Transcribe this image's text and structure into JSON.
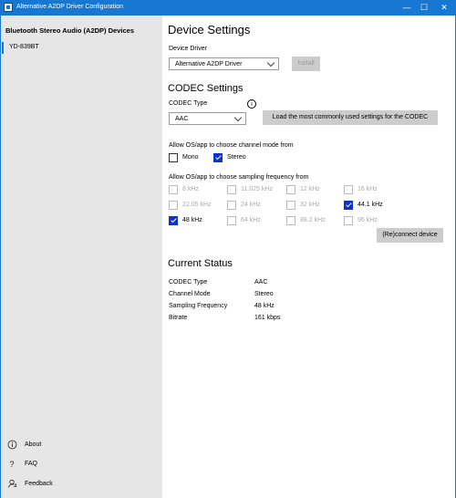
{
  "window": {
    "title": "Alternative A2DP Driver Configuration",
    "minimize": "—",
    "maximize": "☐",
    "close": "✕"
  },
  "sidebar": {
    "header": "Bluetooth Stereo Audio (A2DP) Devices",
    "devices": [
      {
        "label": "YD-839BT",
        "selected": true
      }
    ],
    "footer": [
      {
        "label": "About",
        "icon": "info-icon"
      },
      {
        "label": "FAQ",
        "icon": "question-icon"
      },
      {
        "label": "Feedback",
        "icon": "feedback-icon"
      }
    ]
  },
  "device_settings": {
    "title": "Device Settings",
    "driver_label": "Device Driver",
    "driver_value": "Alternative A2DP Driver",
    "install_label": "Install"
  },
  "codec_settings": {
    "title": "CODEC Settings",
    "type_label": "CODEC Type",
    "type_value": "AAC",
    "load_label": "Load the most commonly used settings for the CODEC",
    "channel_label": "Allow OS/app to choose channel mode from",
    "channels": [
      {
        "label": "Mono",
        "checked": false
      },
      {
        "label": "Stereo",
        "checked": true
      }
    ],
    "freq_label": "Allow OS/app to choose sampling frequency from",
    "frequencies": [
      {
        "label": "8 kHz",
        "checked": false,
        "enabled": false
      },
      {
        "label": "11.025 kHz",
        "checked": false,
        "enabled": false
      },
      {
        "label": "12 kHz",
        "checked": false,
        "enabled": false
      },
      {
        "label": "16 kHz",
        "checked": false,
        "enabled": false
      },
      {
        "label": "22.05 kHz",
        "checked": false,
        "enabled": false
      },
      {
        "label": "24 kHz",
        "checked": false,
        "enabled": false
      },
      {
        "label": "32 kHz",
        "checked": false,
        "enabled": false
      },
      {
        "label": "44.1 kHz",
        "checked": true,
        "enabled": true
      },
      {
        "label": "48 kHz",
        "checked": true,
        "enabled": true
      },
      {
        "label": "64 kHz",
        "checked": false,
        "enabled": false
      },
      {
        "label": "88.2 kHz",
        "checked": false,
        "enabled": false
      },
      {
        "label": "96 kHz",
        "checked": false,
        "enabled": false
      }
    ],
    "reconnect_label": "(Re)connect device"
  },
  "current_status": {
    "title": "Current Status",
    "rows": [
      {
        "label": "CODEC Type",
        "value": "AAC"
      },
      {
        "label": "Channel Mode",
        "value": "Stereo"
      },
      {
        "label": "Sampling Frequency",
        "value": "48 kHz"
      },
      {
        "label": "Bitrate",
        "value": "161 kbps"
      }
    ]
  },
  "colors": {
    "titlebar": "#1778d4",
    "sidebar_bg": "#e6e6e6",
    "checkbox_on": "#0e34c5",
    "button_bg": "#cccccc"
  }
}
